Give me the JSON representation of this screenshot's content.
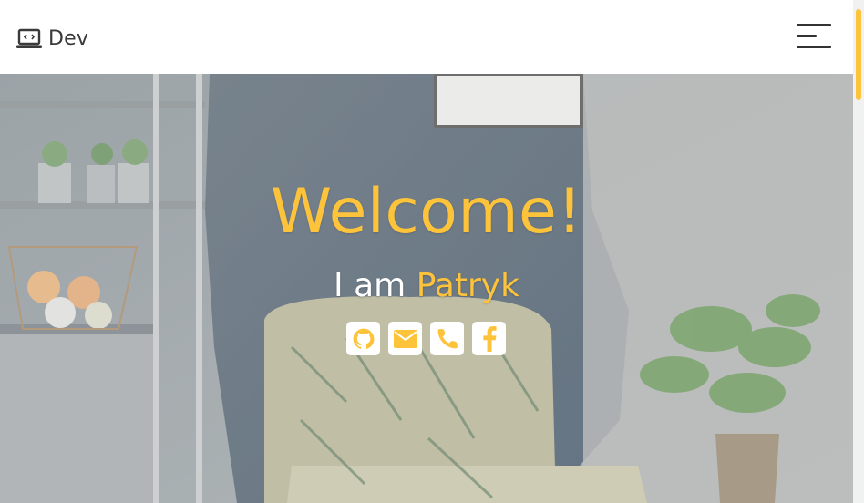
{
  "navbar": {
    "brand_icon": "laptop-code-icon",
    "brand_text": "Dev",
    "menu_icon": "hamburger-menu-icon"
  },
  "hero": {
    "welcome": "Welcome!",
    "intro_prefix": "I am",
    "intro_name": "Patryk",
    "socials": [
      {
        "icon": "github-icon",
        "label": "GitHub"
      },
      {
        "icon": "envelope-icon",
        "label": "Email"
      },
      {
        "icon": "phone-icon",
        "label": "Phone"
      },
      {
        "icon": "facebook-icon",
        "label": "Facebook"
      }
    ]
  },
  "colors": {
    "accent": "#fdc43b",
    "navbar_bg": "#ffffff",
    "text_dark": "#333333"
  }
}
